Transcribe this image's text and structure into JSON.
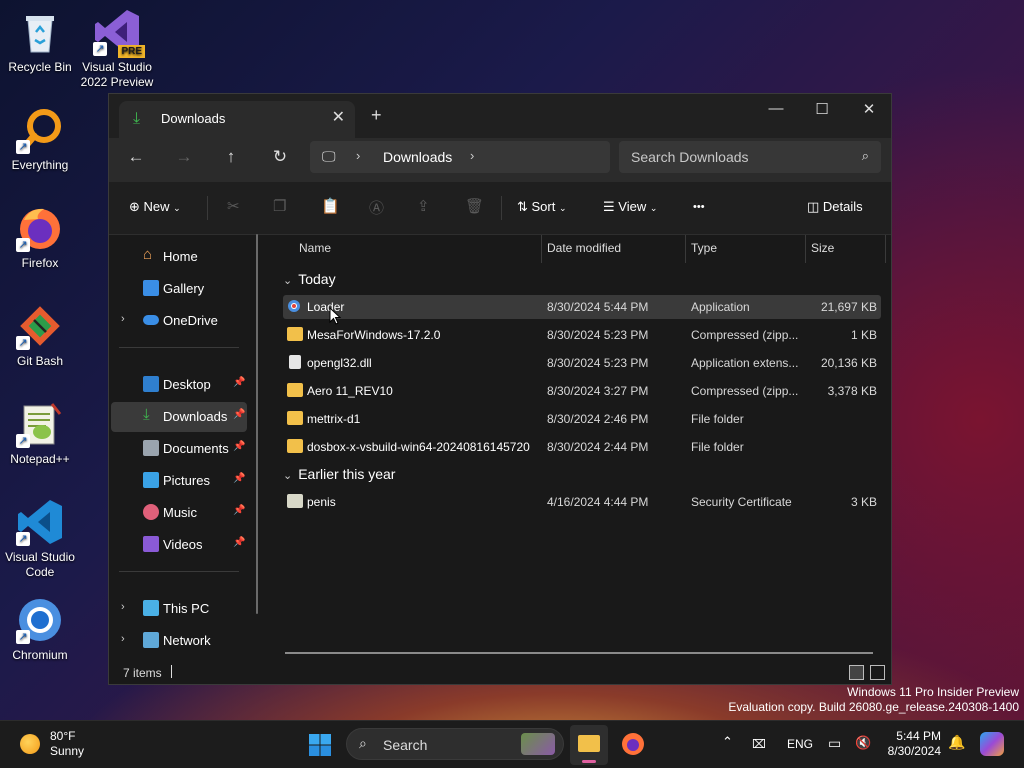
{
  "desktop": {
    "icons": [
      {
        "label": "Recycle Bin"
      },
      {
        "label": "Visual Studio 2022 Preview",
        "badge": "PRE"
      },
      {
        "label": "Everything"
      },
      {
        "label": "Firefox"
      },
      {
        "label": "Git Bash"
      },
      {
        "label": "Notepad++"
      },
      {
        "label": "Visual Studio Code"
      },
      {
        "label": "Chromium"
      }
    ],
    "watermark": {
      "line1": "Windows 11 Pro Insider Preview",
      "line2": "Evaluation copy. Build 26080.ge_release.240308-1400"
    }
  },
  "window": {
    "tab_title": "Downloads",
    "new_tab": "+",
    "address": {
      "crumb": "Downloads"
    },
    "search_placeholder": "Search Downloads",
    "commands": {
      "new_label": "New",
      "sort_label": "Sort",
      "view_label": "View",
      "more_label": "•••",
      "details_label": "Details"
    },
    "nav": {
      "home": "Home",
      "gallery": "Gallery",
      "onedrive": "OneDrive",
      "desktop": "Desktop",
      "downloads": "Downloads",
      "documents": "Documents",
      "pictures": "Pictures",
      "music": "Music",
      "videos": "Videos",
      "thispc": "This PC",
      "network": "Network"
    },
    "columns": {
      "name": "Name",
      "date": "Date modified",
      "type": "Type",
      "size": "Size"
    },
    "groups": {
      "today": "Today",
      "earlier": "Earlier this year"
    },
    "files": [
      {
        "name": "Loader",
        "date": "8/30/2024 5:44 PM",
        "type": "Application",
        "size": "21,697 KB"
      },
      {
        "name": "MesaForWindows-17.2.0",
        "date": "8/30/2024 5:23 PM",
        "type": "Compressed (zipp...",
        "size": "1 KB"
      },
      {
        "name": "opengl32.dll",
        "date": "8/30/2024 5:23 PM",
        "type": "Application extens...",
        "size": "20,136 KB"
      },
      {
        "name": "Aero 11_REV10",
        "date": "8/30/2024 3:27 PM",
        "type": "Compressed (zipp...",
        "size": "3,378 KB"
      },
      {
        "name": "mettrix-d1",
        "date": "8/30/2024 2:46 PM",
        "type": "File folder",
        "size": ""
      },
      {
        "name": "dosbox-x-vsbuild-win64-20240816145720",
        "date": "8/30/2024 2:44 PM",
        "type": "File folder",
        "size": ""
      },
      {
        "name": "penis",
        "date": "4/16/2024 4:44 PM",
        "type": "Security Certificate",
        "size": "3 KB"
      }
    ],
    "status": {
      "count": "7 items"
    }
  },
  "taskbar": {
    "weather_temp": "80°F",
    "weather_desc": "Sunny",
    "search_placeholder": "Search",
    "lang": "ENG",
    "time": "5:44 PM",
    "date": "8/30/2024"
  },
  "colors": {
    "accent": "#3fb950",
    "folder": "#f2c04a",
    "onedrive": "#3a8ee6",
    "selected_row": "#3a3a3a"
  }
}
